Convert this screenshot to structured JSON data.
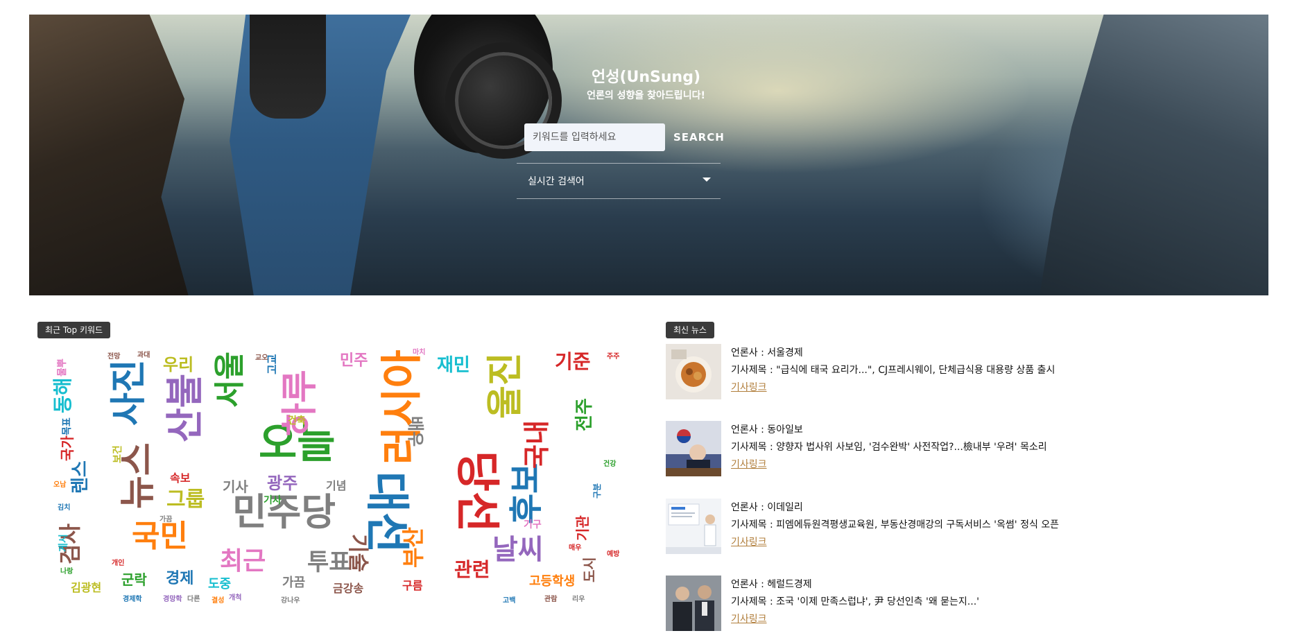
{
  "hero": {
    "title": "언성(UnSung)",
    "subtitle": "언론의 성향을 찾아드립니다!",
    "search_placeholder": "키워드를 입력하세요",
    "search_button": "SEARCH",
    "realtime_label": "실시간 검색어"
  },
  "keywords": {
    "tag": "최근 Top 키워드",
    "cloud_words": [
      {
        "text": "대선",
        "color": "#1f77b4",
        "size": 64,
        "rotate": 90
      },
      {
        "text": "당선",
        "color": "#d62728",
        "size": 64,
        "rotate": 90
      },
      {
        "text": "오늘",
        "color": "#2ca02c",
        "size": 60,
        "rotate": 0
      },
      {
        "text": "러시아",
        "color": "#ff7f0e",
        "size": 60,
        "rotate": -90
      },
      {
        "text": "민주당",
        "color": "#7f7f7f",
        "size": 54,
        "rotate": 0
      },
      {
        "text": "하루",
        "color": "#e377c2",
        "size": 52,
        "rotate": -90
      },
      {
        "text": "사진",
        "color": "#1f77b4",
        "size": 52,
        "rotate": -90
      },
      {
        "text": "뉴스",
        "color": "#8c564b",
        "size": 52,
        "rotate": -90
      },
      {
        "text": "울진",
        "color": "#bcbd22",
        "size": 52,
        "rotate": -90
      },
      {
        "text": "산불",
        "color": "#9467bd",
        "size": 54,
        "rotate": -90
      },
      {
        "text": "서울",
        "color": "#2ca02c",
        "size": 44,
        "rotate": -90
      },
      {
        "text": "후보",
        "color": "#1f77b4",
        "size": 48,
        "rotate": -90
      },
      {
        "text": "국민",
        "color": "#ff7f0e",
        "size": 44,
        "rotate": 0
      },
      {
        "text": "국내",
        "color": "#d62728",
        "size": 38,
        "rotate": -90
      },
      {
        "text": "날씨",
        "color": "#9467bd",
        "size": 40,
        "rotate": 0
      },
      {
        "text": "최근",
        "color": "#e377c2",
        "size": 36,
        "rotate": 0
      },
      {
        "text": "투표",
        "color": "#7f7f7f",
        "size": 34,
        "rotate": 0
      },
      {
        "text": "부산",
        "color": "#ff7f0e",
        "size": 32,
        "rotate": -90
      },
      {
        "text": "관련",
        "color": "#d62728",
        "size": 28,
        "rotate": 0
      },
      {
        "text": "기술",
        "color": "#8c564b",
        "size": 30,
        "rotate": 90
      },
      {
        "text": "그룹",
        "color": "#bcbd22",
        "size": 30,
        "rotate": 0
      },
      {
        "text": "검사",
        "color": "#8c564b",
        "size": 32,
        "rotate": -90
      },
      {
        "text": "동해",
        "color": "#17becf",
        "size": 28,
        "rotate": -90
      },
      {
        "text": "렌스",
        "color": "#1f77b4",
        "size": 26,
        "rotate": -90
      },
      {
        "text": "재민",
        "color": "#17becf",
        "size": 26,
        "rotate": 0
      },
      {
        "text": "기준",
        "color": "#d62728",
        "size": 28,
        "rotate": 0
      },
      {
        "text": "전주",
        "color": "#2ca02c",
        "size": 26,
        "rotate": -90
      },
      {
        "text": "우리",
        "color": "#bcbd22",
        "size": 24,
        "rotate": 0
      },
      {
        "text": "광주",
        "color": "#9467bd",
        "size": 24,
        "rotate": 0
      },
      {
        "text": "민주",
        "color": "#e377c2",
        "size": 22,
        "rotate": 0
      },
      {
        "text": "배우",
        "color": "#7f7f7f",
        "size": 24,
        "rotate": 90
      },
      {
        "text": "기사",
        "color": "#7f7f7f",
        "size": 20,
        "rotate": 0
      },
      {
        "text": "기념",
        "color": "#7f7f7f",
        "size": 16,
        "rotate": 0
      },
      {
        "text": "경제",
        "color": "#1f77b4",
        "size": 22,
        "rotate": 0
      },
      {
        "text": "군락",
        "color": "#2ca02c",
        "size": 20,
        "rotate": 0
      },
      {
        "text": "도중",
        "color": "#17becf",
        "size": 18,
        "rotate": 0
      },
      {
        "text": "가끔",
        "color": "#7f7f7f",
        "size": 18,
        "rotate": 0
      },
      {
        "text": "고등학생",
        "color": "#ff7f0e",
        "size": 18,
        "rotate": 0
      },
      {
        "text": "기관",
        "color": "#d62728",
        "size": 20,
        "rotate": -90
      },
      {
        "text": "도시",
        "color": "#8c564b",
        "size": 20,
        "rotate": -90
      },
      {
        "text": "국가",
        "color": "#d62728",
        "size": 20,
        "rotate": -90
      },
      {
        "text": "속보",
        "color": "#d62728",
        "size": 16,
        "rotate": 0
      },
      {
        "text": "구름",
        "color": "#d62728",
        "size": 16,
        "rotate": 0
      },
      {
        "text": "금강송",
        "color": "#8c564b",
        "size": 16,
        "rotate": 0
      },
      {
        "text": "김광현",
        "color": "#bcbd22",
        "size": 16,
        "rotate": 0
      },
      {
        "text": "게시",
        "color": "#17becf",
        "size": 14,
        "rotate": -90
      },
      {
        "text": "기구",
        "color": "#e377c2",
        "size": 14,
        "rotate": 0
      },
      {
        "text": "목표",
        "color": "#1f77b4",
        "size": 14,
        "rotate": -90
      },
      {
        "text": "물뿌",
        "color": "#e377c2",
        "size": 14,
        "rotate": -90
      },
      {
        "text": "보건",
        "color": "#bcbd22",
        "size": 14,
        "rotate": -90
      },
      {
        "text": "전망",
        "color": "#8c564b",
        "size": 10,
        "rotate": 0
      },
      {
        "text": "과대",
        "color": "#8c564b",
        "size": 10,
        "rotate": 0
      },
      {
        "text": "고교",
        "color": "#1f77b4",
        "size": 16,
        "rotate": -90
      },
      {
        "text": "건축",
        "color": "#bcbd22",
        "size": 14,
        "rotate": 0
      },
      {
        "text": "기사",
        "color": "#2ca02c",
        "size": 14,
        "rotate": 0
      },
      {
        "text": "주주",
        "color": "#d62728",
        "size": 10,
        "rotate": 0
      },
      {
        "text": "오남",
        "color": "#ff7f0e",
        "size": 10,
        "rotate": 0
      },
      {
        "text": "김치",
        "color": "#1f77b4",
        "size": 10,
        "rotate": 0
      },
      {
        "text": "나랑",
        "color": "#2ca02c",
        "size": 10,
        "rotate": 0
      },
      {
        "text": "경제학",
        "color": "#1f77b4",
        "size": 10,
        "rotate": 0
      },
      {
        "text": "경망학",
        "color": "#9467bd",
        "size": 10,
        "rotate": 0
      },
      {
        "text": "다른",
        "color": "#7f7f7f",
        "size": 10,
        "rotate": 0
      },
      {
        "text": "교오",
        "color": "#8c564b",
        "size": 10,
        "rotate": 0
      },
      {
        "text": "마치",
        "color": "#e377c2",
        "size": 10,
        "rotate": 0
      },
      {
        "text": "가끔",
        "color": "#7f7f7f",
        "size": 10,
        "rotate": 0
      },
      {
        "text": "건강",
        "color": "#2ca02c",
        "size": 10,
        "rotate": 0
      },
      {
        "text": "구분",
        "color": "#1f77b4",
        "size": 12,
        "rotate": -90
      },
      {
        "text": "매우",
        "color": "#d62728",
        "size": 10,
        "rotate": 0
      },
      {
        "text": "리우",
        "color": "#7f7f7f",
        "size": 10,
        "rotate": 0
      },
      {
        "text": "관람",
        "color": "#8c564b",
        "size": 10,
        "rotate": 0
      },
      {
        "text": "고백",
        "color": "#1f77b4",
        "size": 10,
        "rotate": 0
      },
      {
        "text": "예방",
        "color": "#d62728",
        "size": 10,
        "rotate": 0
      },
      {
        "text": "강나우",
        "color": "#7f7f7f",
        "size": 10,
        "rotate": 0
      },
      {
        "text": "개인",
        "color": "#d62728",
        "size": 10,
        "rotate": 0
      },
      {
        "text": "결성",
        "color": "#ff7f0e",
        "size": 10,
        "rotate": 0
      },
      {
        "text": "개척",
        "color": "#9467bd",
        "size": 10,
        "rotate": 0
      }
    ]
  },
  "news": {
    "tag": "최신 뉴스",
    "press_prefix": "언론사 : ",
    "title_prefix": "기사제목 : ",
    "link_label": "기사링크",
    "items": [
      {
        "press": "서울경제",
        "title": "\"급식에 태국 요리가...\", CJ프레시웨이, 단체급식용 대용량 상품 출시",
        "thumb": "food"
      },
      {
        "press": "동아일보",
        "title": "양향자 법사위 사보임, '검수완박' 사전작업?...檢내부 '우려' 목소리",
        "thumb": "flag"
      },
      {
        "press": "이데일리",
        "title": "피엠에듀원격평생교육원, 부동산경매강의 구독서비스 '옥썸' 정식 오픈",
        "thumb": "lecture"
      },
      {
        "press": "헤럴드경제",
        "title": "조국 '이제 만족스럽냐', 尹 당선인측 '왜 묻는지...'",
        "thumb": "people"
      }
    ]
  }
}
